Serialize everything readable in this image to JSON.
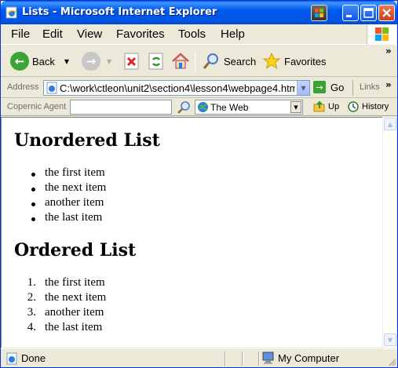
{
  "window": {
    "title": "Lists - Microsoft Internet Explorer"
  },
  "menu": [
    "File",
    "Edit",
    "View",
    "Favorites",
    "Tools",
    "Help"
  ],
  "toolbar": {
    "back": "Back",
    "search": "Search",
    "favorites": "Favorites"
  },
  "address": {
    "label": "Address",
    "url": "C:\\work\\ctleon\\unit2\\section4\\lesson4\\webpage4.htm",
    "go": "Go",
    "links": "Links"
  },
  "copernic": {
    "label": "Copernic Agent",
    "input_value": "",
    "scope": "The Web",
    "up": "Up",
    "history": "History"
  },
  "page": {
    "unordered_heading": "Unordered List",
    "unordered_items": [
      "the first item",
      "the next item",
      "another item",
      "the last item"
    ],
    "ordered_heading": "Ordered List",
    "ordered_numbers": [
      "1.",
      "2.",
      "3.",
      "4."
    ],
    "ordered_items": [
      "the first item",
      "the next item",
      "another item",
      "the last item"
    ]
  },
  "status": {
    "text": "Done",
    "zone": "My Computer"
  },
  "colors": {
    "titlebar": "#0054e3",
    "chrome": "#ece9d8",
    "close": "#c8401f"
  }
}
